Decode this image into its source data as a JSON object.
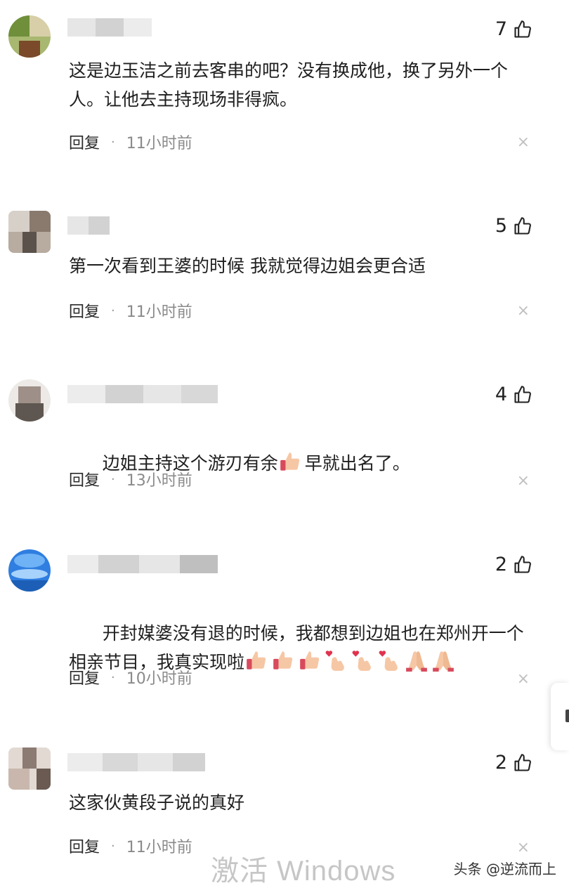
{
  "colors": {
    "avatar_1": [
      "#6f8f3a",
      "#a8b870",
      "#d8cfa8",
      "#7a4a2a"
    ],
    "avatar_2": [
      "#8a7a6e",
      "#b8ab9f",
      "#5b524c",
      "#d7d0c8"
    ],
    "avatar_3": [
      "#ece9e6",
      "#9e9088",
      "#5e5650",
      "#c8c0b8"
    ],
    "avatar_4": [
      "#2f7ee0",
      "#6fb2f5",
      "#1d5fb6",
      "#a7d2fb"
    ],
    "avatar_5": [
      "#e2d9d3",
      "#8c7b73",
      "#c9b7ad",
      "#6a5a52"
    ],
    "username_blur": [
      "#e6e6e6",
      "#d2d2d2",
      "#bfbfbf",
      "#ececec"
    ]
  },
  "comments": [
    {
      "likes": "7",
      "text": "这是边玉洁之前去客串的吧？没有换成他，换了另外一个人。让他去主持现场非得疯。",
      "emojis": [],
      "reply_label": "回复",
      "time": "11小时前"
    },
    {
      "likes": "5",
      "text": "第一次看到王婆的时候 我就觉得边姐会更合适",
      "emojis": [],
      "reply_label": "回复",
      "time": "11小时前"
    },
    {
      "likes": "4",
      "text": "边姐主持这个游刃有余",
      "text_after": "早就出名了。",
      "emojis": [
        "thumbs-up"
      ],
      "reply_label": "回复",
      "time": "13小时前"
    },
    {
      "likes": "2",
      "text": "开封媒婆没有退的时候，我都想到边姐也在郑州开一个相亲节目，我真实现啦",
      "emojis": [
        "thumbs-up",
        "thumbs-up",
        "thumbs-up",
        "finger-heart",
        "finger-heart",
        "finger-heart",
        "pray",
        "pray"
      ],
      "reply_label": "回复",
      "time": "10小时前"
    },
    {
      "likes": "2",
      "text": "这家伙黄段子说的真好",
      "emojis": [],
      "reply_label": "回复",
      "time": "11小时前"
    }
  ],
  "close_glyph": "×",
  "dot_glyph": "·",
  "watermark": "激活 Windows",
  "credit": "头条 @逆流而上"
}
